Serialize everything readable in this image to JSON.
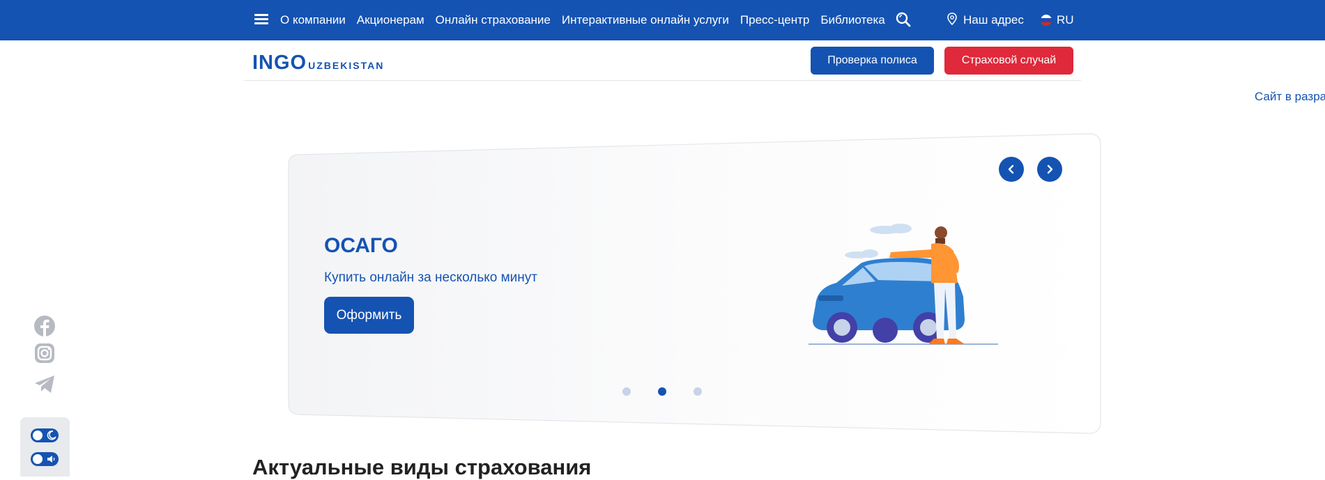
{
  "topbar": {
    "menu_icon": "hamburger-menu-icon",
    "nav": [
      "О компании",
      "Акционерам",
      "Онлайн страхование",
      "Интерактивные онлайн услуги",
      "Пресс-центр",
      "Библиотека"
    ],
    "search_icon": "search-icon",
    "address_icon": "map-pin-icon",
    "address_label": "Наш адрес",
    "language": "RU",
    "language_flag": "russia-flag-icon"
  },
  "header": {
    "logo_main": "INGO",
    "logo_sub": "UZBEKISTAN",
    "check_policy_label": "Проверка полиса",
    "insurance_case_label": "Страховой случай"
  },
  "dev_notice": "Сайт в разработке",
  "slider": {
    "title": "ОСАГО",
    "subtitle": "Купить онлайн за несколько минут",
    "button_label": "Оформить",
    "prev_icon": "chevron-left-icon",
    "next_icon": "chevron-right-icon",
    "slide_count": 3,
    "active_slide": 2,
    "illustration": "man-leaning-on-car-illustration"
  },
  "social": [
    "facebook-icon",
    "instagram-icon",
    "telegram-icon"
  ],
  "accessibility": {
    "dark_mode_icon": "moon-icon",
    "sound_icon": "speaker-icon"
  },
  "section": {
    "title": "Актуальные виды страхования"
  },
  "colors": {
    "brand_blue": "#1553b2",
    "danger_red": "#e0293b",
    "slide_bg": "#f7f8fa"
  }
}
